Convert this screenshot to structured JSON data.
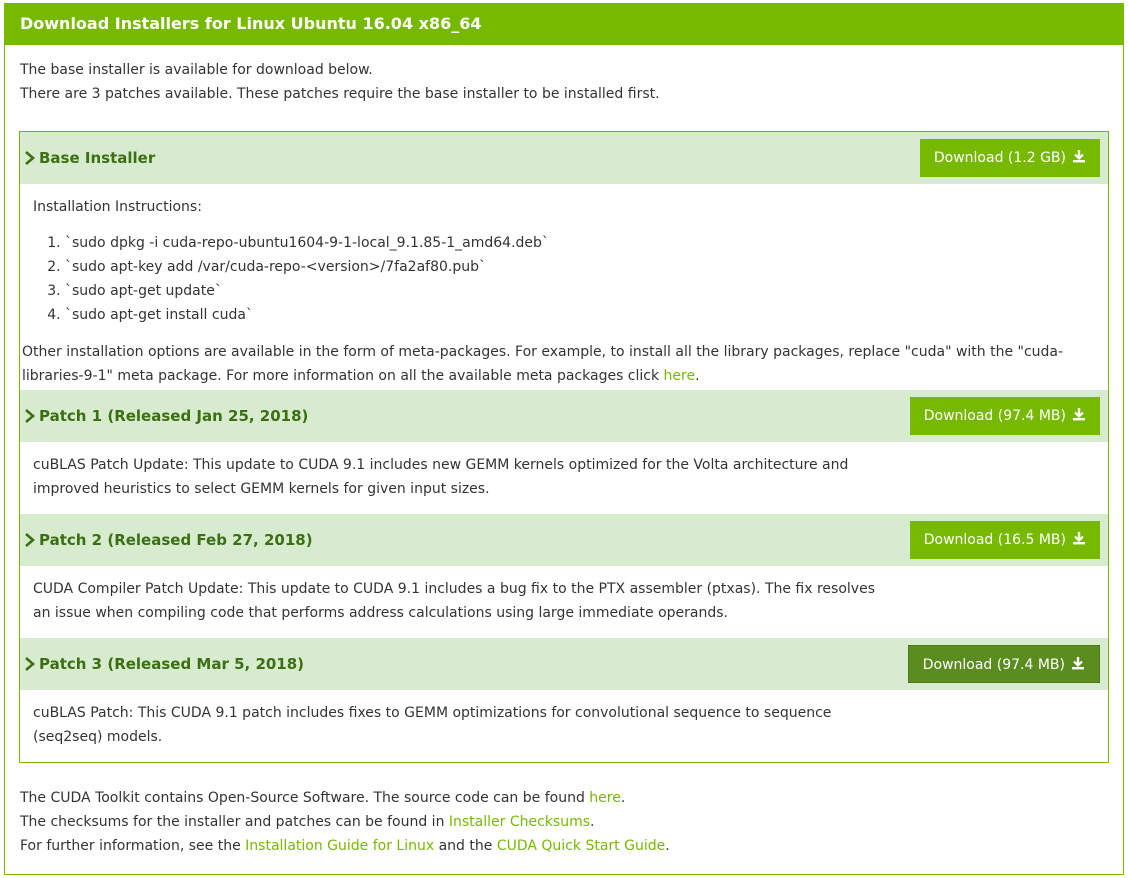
{
  "header": {
    "title": "Download Installers for Linux Ubuntu 16.04 x86_64"
  },
  "intro": {
    "line1": "The base installer is available for download below.",
    "line2": "There are 3 patches available. These patches require the base installer to be installed first."
  },
  "base": {
    "title": "Base Installer",
    "download_label": "Download (1.2 GB)",
    "instructions_label": "Installation Instructions:",
    "steps": [
      "`sudo dpkg -i cuda-repo-ubuntu1604-9-1-local_9.1.85-1_amd64.deb`",
      "`sudo apt-key add /var/cuda-repo-<version>/7fa2af80.pub`",
      "`sudo apt-get update`",
      "`sudo apt-get install cuda`"
    ],
    "other_line1": "Other installation options are available in the form of meta-packages. For example, to install all the library packages, replace \"cuda\" with the \"cuda-",
    "other_line2": "libraries-9-1\" meta package. For more information on all the available meta packages click ",
    "other_link": "here",
    "other_end": "."
  },
  "patches": [
    {
      "title": "Patch 1 (Released Jan 25, 2018)",
      "download_label": "Download (97.4 MB)",
      "desc_line1": "cuBLAS Patch Update: This update to CUDA 9.1 includes new GEMM kernels optimized for the Volta architecture and",
      "desc_line2": "improved heuristics to select GEMM kernels for given input sizes."
    },
    {
      "title": "Patch 2 (Released Feb 27, 2018)",
      "download_label": "Download (16.5 MB)",
      "desc_line1": "CUDA Compiler Patch Update: This update to CUDA 9.1 includes a bug fix to the PTX assembler (ptxas). The fix resolves",
      "desc_line2": "an issue when compiling code that performs address calculations using large immediate operands."
    },
    {
      "title": "Patch 3 (Released Mar 5, 2018)",
      "download_label": "Download (97.4 MB)",
      "desc_line1": "cuBLAS Patch: This CUDA 9.1 patch includes fixes to GEMM optimizations for convolutional sequence to sequence",
      "desc_line2": "(seq2seq) models."
    }
  ],
  "footer": {
    "l1_text": "The CUDA Toolkit contains Open-Source Software. The source code can be found ",
    "l1_link": "here",
    "l1_end": ".",
    "l2_text": "The checksums for the installer and patches can be found in ",
    "l2_link": "Installer Checksums",
    "l2_end": ".",
    "l3_text": "For further information, see the ",
    "l3_link1": "Installation Guide for Linux",
    "l3_mid": " and the ",
    "l3_link2": "CUDA Quick Start Guide",
    "l3_end": "."
  },
  "colors": {
    "accent": "#76b900",
    "section_bg": "#d7ecce",
    "title_green": "#3c6e13",
    "active_button": "#5b8c1f"
  },
  "icons": {
    "section_toggle": "chevron-right-icon",
    "download": "download-icon"
  }
}
